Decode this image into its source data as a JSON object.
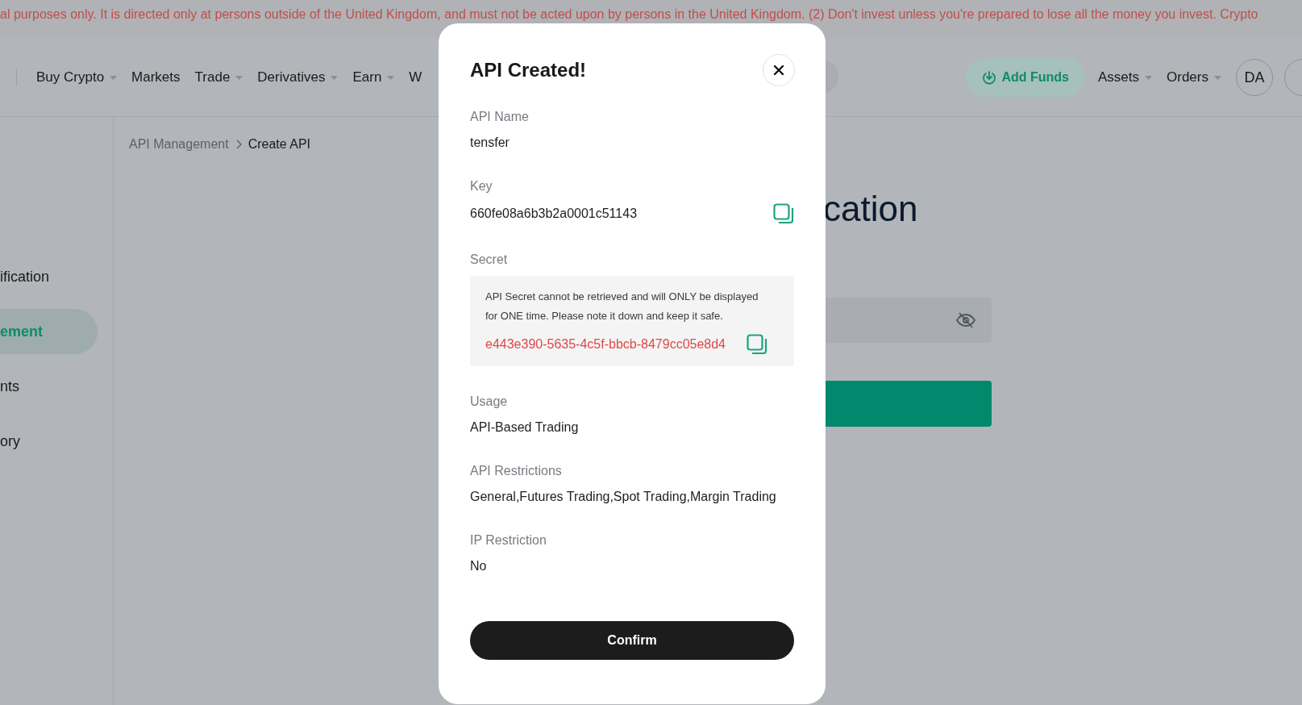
{
  "banner": {
    "text": "al purposes only. It is directed only at persons outside of the United Kingdom, and must not be acted upon by persons in the United Kingdom. (2) Don't invest unless you're prepared to lose all the money you invest. Crypto"
  },
  "nav": {
    "items": [
      {
        "label": "Buy Crypto",
        "dropdown": true
      },
      {
        "label": "Markets",
        "dropdown": false
      },
      {
        "label": "Trade",
        "dropdown": true
      },
      {
        "label": "Derivatives",
        "dropdown": true
      },
      {
        "label": "Earn",
        "dropdown": true
      },
      {
        "label": "W",
        "dropdown": false
      }
    ],
    "add_funds": "Add Funds",
    "right_items": [
      {
        "label": "Assets",
        "dropdown": true
      },
      {
        "label": "Orders",
        "dropdown": true
      }
    ],
    "avatar": "DA"
  },
  "sidebar": {
    "items": [
      {
        "label": "ification",
        "selected": false
      },
      {
        "label": "ement",
        "selected": true
      },
      {
        "label": "nts",
        "selected": false
      },
      {
        "label": "ory",
        "selected": false
      }
    ]
  },
  "breadcrumb": [
    {
      "label": "API Management",
      "current": false
    },
    {
      "label": "Create API",
      "current": true
    }
  ],
  "page": {
    "heading": "cation"
  },
  "modal": {
    "title": "API Created!",
    "fields": [
      {
        "kind": "text",
        "label": "API Name",
        "value": "tensfer"
      },
      {
        "kind": "copy",
        "label": "Key",
        "value": "660fe08a6b3b2a0001c51143"
      },
      {
        "kind": "secret",
        "label": "Secret",
        "note": "API Secret cannot be retrieved and will ONLY be displayed for ONE time. Please note it down and keep it safe.",
        "value": "e443e390-5635-4c5f-bbcb-8479cc05e8d4"
      },
      {
        "kind": "text",
        "label": "Usage",
        "value": "API-Based Trading"
      },
      {
        "kind": "text",
        "label": "API Restrictions",
        "value": "General,Futures Trading,Spot Trading,Margin Trading"
      },
      {
        "kind": "text",
        "label": "IP Restriction",
        "value": "No"
      }
    ],
    "confirm": "Confirm"
  }
}
